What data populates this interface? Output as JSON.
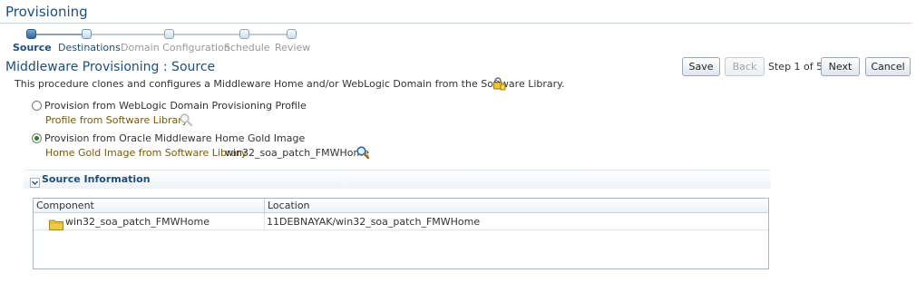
{
  "page": {
    "title": "Provisioning"
  },
  "train": {
    "steps": [
      {
        "label": "Source",
        "state": "current"
      },
      {
        "label": "Destinations",
        "state": "visited"
      },
      {
        "label": "Domain Configuration",
        "state": "upcoming"
      },
      {
        "label": "Schedule",
        "state": "upcoming"
      },
      {
        "label": "Review",
        "state": "upcoming"
      }
    ]
  },
  "header": {
    "title": "Middleware Provisioning : Source",
    "description": "This procedure clones and configures a Middleware Home and/or WebLogic Domain from the Software Library."
  },
  "toolbar": {
    "save_label": "Save",
    "back_label": "Back",
    "step_text": "Step 1 of 5",
    "next_label": "Next",
    "cancel_label": "Cancel"
  },
  "options": {
    "domain_profile": {
      "label": "Provision from WebLogic Domain Provisioning Profile",
      "selected": false,
      "field_label": "Profile from Software Library",
      "field_value": ""
    },
    "gold_image": {
      "label": "Provision from Oracle Middleware Home Gold Image",
      "selected": true,
      "field_label": "Home Gold Image from Software Library",
      "field_value": "win32_soa_patch_FMWHome"
    }
  },
  "source_info": {
    "title": "Source Information",
    "columns": [
      "Component",
      "Location"
    ],
    "rows": [
      {
        "component": "win32_soa_patch_FMWHome",
        "location": "11DEBNAYAK/win32_soa_patch_FMWHome",
        "icon": "folder-icon"
      }
    ]
  },
  "colors": {
    "accent": "#1e4f7a",
    "field_label": "#7a5b00",
    "selected_radio": "#2e7d32"
  }
}
